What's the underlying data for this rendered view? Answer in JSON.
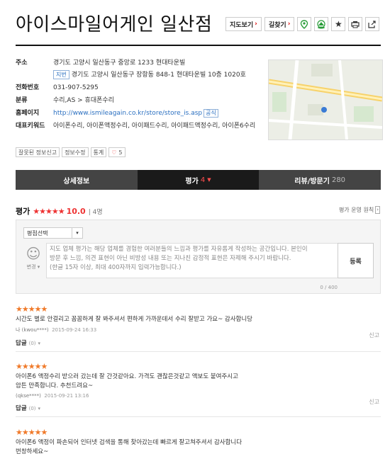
{
  "header": {
    "title": "아이스마일어게인 일산점",
    "btn_map": "지도보기",
    "btn_route": "길찾기",
    "icons": [
      "map-pin-icon",
      "navigation-icon",
      "star-icon",
      "print-icon",
      "share-icon"
    ]
  },
  "info": {
    "address_label": "주소",
    "address": "경기도 고양시 일산동구 중앙로 1233 현대타운빌",
    "jibun_tag": "지번",
    "jibun_address": "경기도 고양시 일산동구 장항동 848-1 현대타운빌 10층 1020호",
    "phone_label": "전화번호",
    "phone": "031-907-5295",
    "category_label": "분류",
    "category": "수리,AS > 휴대폰수리",
    "homepage_label": "홈페이지",
    "homepage": "http://www.ismileagain.co.kr/store/store_is.asp",
    "homepage_tag": "공식",
    "keywords_label": "대표키워드",
    "keywords": "아이폰수리, 아이폰액정수리, 아이패드수리, 아이패드액정수리, 아이폰6수리"
  },
  "actions": {
    "wrong_info": "잘못된 정보신고",
    "edit_info": "정보수정",
    "stats": "통계",
    "likes": "5"
  },
  "tabs": {
    "detail": "상세정보",
    "rating": "평가",
    "rating_count": "4",
    "review": "리뷰/방문기",
    "review_count": "280"
  },
  "rating_section": {
    "heading": "평가",
    "stars": "★★★★★",
    "score": "10.0",
    "count": "4명",
    "policy": "평가 운영 원칙"
  },
  "write_form": {
    "select_label": "평점선택",
    "change_label": "변경",
    "placeholder_line1": "지도 업체 평가는 해당 업체를 경험한 여러분들의 느낌과 평가를 자유롭게 작성하는 공간입니다. 본인이",
    "placeholder_line2": "방문 후 느낌, 의견 표현이 아닌 비방성 내용 또는 지나친 감정적 표현은 자제해 주시기 바랍니다.",
    "placeholder_line3": "(한글 15자 이상, 최대 400자까지 입력가능합니다.)",
    "submit": "등록",
    "counter": "0 / 400"
  },
  "reviews": [
    {
      "stars": "★★★★★",
      "text": "시간도 별로 안걸리고 꼼꼼하게 잘 봐주셔서 편하게 가까운데서 수리 잘받고 가요~ 감사합니당",
      "author": "나 (kwou****)",
      "date": "2015-09-24 16:33",
      "report": "신고",
      "reply": "답글",
      "reply_count": "(0)"
    },
    {
      "stars": "★★★★★",
      "text": "아이폰6 액정수리 받으러 갔는데 잘 간것같아요. 가격도 괜찮은것같고 액보도 붙여주시고",
      "text2": "암튼 만족합니다. 추천드려요~",
      "author": "(qkse****)",
      "date": "2015-09-21 13:16",
      "report": "신고",
      "reply": "답글",
      "reply_count": "(0)"
    },
    {
      "stars": "★★★★★",
      "text": "아이폰6 액정이 파손되어 인터넷 검색을 통해 찾아갔는데 빠르게 잘고쳐주셔서 감사합니다",
      "text2": "번창하세요~"
    }
  ]
}
